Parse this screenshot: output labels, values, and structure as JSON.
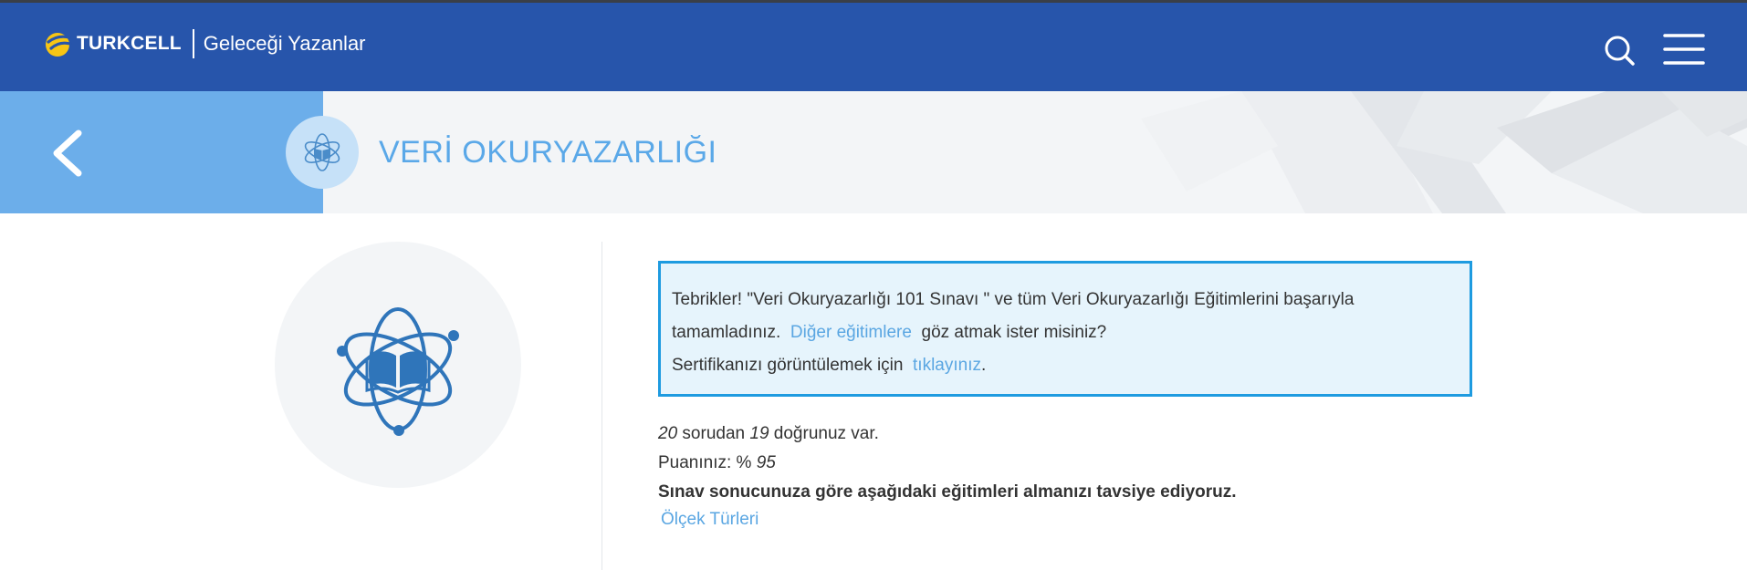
{
  "header": {
    "brand": "TURKCELL",
    "tagline": "Geleceği Yazanlar",
    "colors": {
      "background": "#2755ab",
      "logo_accent": "#f7c514"
    },
    "icons": [
      "search-icon",
      "menu-icon"
    ]
  },
  "hero": {
    "course_title": "VERİ OKURYAZARLIĞI",
    "icons": [
      "back-chevron-icon",
      "course-badge-icon"
    ],
    "colors": {
      "left_panel": "#6caeea",
      "title": "#5aa8e8"
    }
  },
  "result": {
    "alert": {
      "line1": "Tebrikler! \"Veri Okuryazarlığı 101 Sınavı \" ve tüm Veri Okuryazarlığı Eğitimlerini başarıyla",
      "line2_before": "tamamladınız.",
      "line2_link": "Diğer eğitimlere",
      "line2_after": "göz atmak ister misiniz?",
      "line3_before": "Sertifikanızı görüntülemek için",
      "line3_link": "tıklayınız",
      "line3_after": "."
    },
    "total_questions": "20",
    "questions_text": "sorudan",
    "correct_count": "19",
    "correct_text": "doğrunuz var.",
    "score_label": "Puanınız: %",
    "score_value": "95",
    "recommendation": "Sınav sonucunuza göre aşağıdaki eğitimleri almanızı tavsiye ediyoruz.",
    "recommended_courses": [
      "Ölçek Türleri"
    ]
  }
}
